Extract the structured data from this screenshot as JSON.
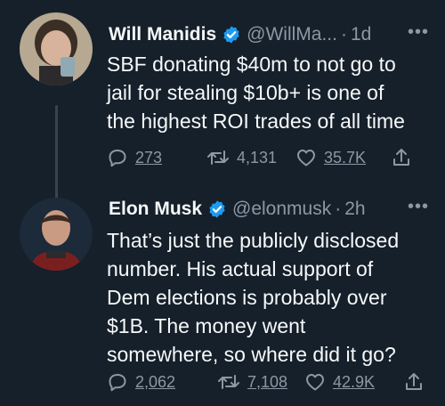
{
  "tweets": [
    {
      "author": "Will Manidis",
      "handle": "@WillMa...",
      "separator": "·",
      "time": "1d",
      "text": "SBF donating $40m to not go to\njail for stealing $10b+ is one of\nthe highest ROI trades of all time",
      "replies": "273",
      "retweets": "4,131",
      "likes": "35.7K"
    },
    {
      "author": "Elon Musk",
      "handle": "@elonmusk",
      "separator": "·",
      "time": "2h",
      "text": "That’s just the publicly disclosed\nnumber. His actual support of\nDem elections is probably over\n$1B. The money went\nsomewhere, so where did it go?",
      "replies": "2,062",
      "retweets": "7,108",
      "likes": "42.9K"
    }
  ],
  "icons": {
    "more": "more-icon",
    "verified": "verified-badge-icon",
    "reply": "reply-icon",
    "retweet": "retweet-icon",
    "like": "like-icon",
    "share": "share-icon"
  },
  "colors": {
    "background": "#15202b",
    "text": "#f7f9f9",
    "muted": "#8b98a5",
    "verified": "#1d9bf0",
    "thread_line": "#38444d"
  }
}
